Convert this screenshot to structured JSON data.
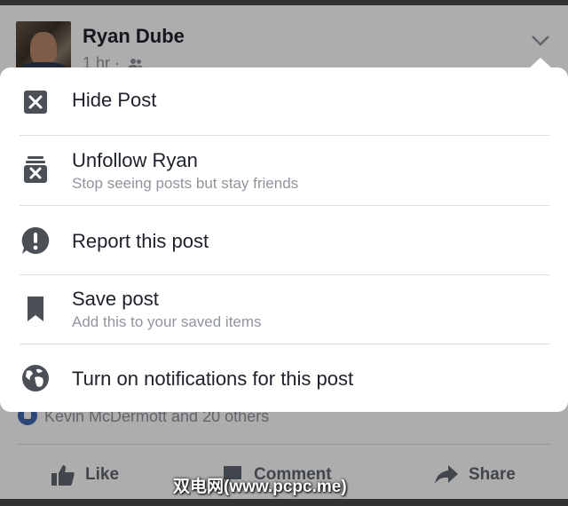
{
  "post": {
    "author": "Ryan Dube",
    "meta": "1 hr ·",
    "reactions_text": "Kevin McDermott and 20 others"
  },
  "actions": {
    "like": "Like",
    "comment": "Comment",
    "share": "Share"
  },
  "menu": {
    "items": [
      {
        "title": "Hide Post",
        "subtitle": "",
        "icon": "hide-box-x-icon"
      },
      {
        "title": "Unfollow Ryan",
        "subtitle": "Stop seeing posts but stay friends",
        "icon": "unfollow-stack-x-icon"
      },
      {
        "title": "Report this post",
        "subtitle": "",
        "icon": "exclamation-speech-icon"
      },
      {
        "title": "Save post",
        "subtitle": "Add this to your saved items",
        "icon": "bookmark-icon"
      },
      {
        "title": "Turn on notifications for this post",
        "subtitle": "",
        "icon": "globe-icon"
      }
    ]
  },
  "watermark": "双电网(www.pcpc.me)",
  "colors": {
    "text_primary": "#1d2129",
    "text_secondary": "#90949c",
    "icon": "#4b4f56",
    "brand": "#4267b2"
  }
}
